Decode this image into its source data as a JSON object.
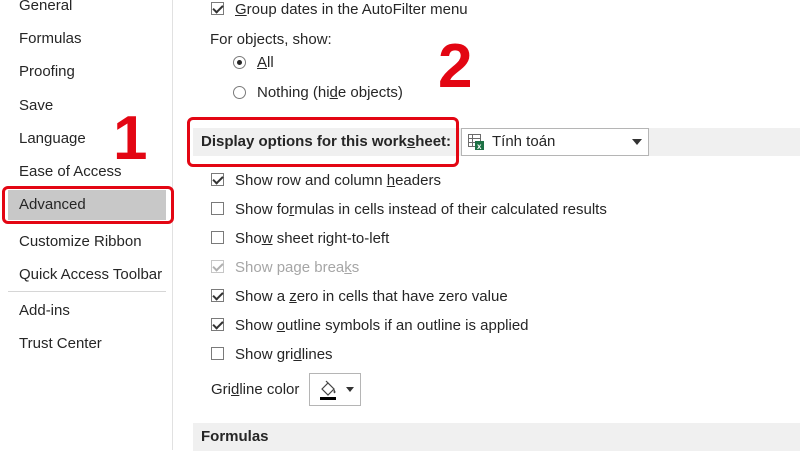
{
  "sidebar": {
    "items": [
      {
        "label": "General"
      },
      {
        "label": "Formulas"
      },
      {
        "label": "Proofing"
      },
      {
        "label": "Save"
      },
      {
        "label": "Language"
      },
      {
        "label": "Ease of Access"
      },
      {
        "label": "Advanced",
        "selected": true
      },
      {
        "label": "Customize Ribbon"
      },
      {
        "label": "Quick Access Toolbar"
      },
      {
        "label": "Add-ins"
      },
      {
        "label": "Trust Center"
      }
    ]
  },
  "annotations": {
    "step1": "1",
    "step2": "2",
    "highlight_color": "#e30613"
  },
  "main": {
    "group_dates": {
      "label_pre": "",
      "label_ul": "G",
      "label_post": "roup dates in the AutoFilter menu",
      "checked": true
    },
    "for_objects_label": "For objects, show:",
    "radio_all": {
      "label_pre": "",
      "label_ul": "A",
      "label_post": "ll",
      "selected": true
    },
    "radio_nothing": {
      "label_pre": "Nothing (hi",
      "label_ul": "d",
      "label_post": "e objects)",
      "selected": false
    },
    "display_section": {
      "title_pre": "Display options for this work",
      "title_ul": "s",
      "title_post": "heet:",
      "worksheet_select": {
        "value": "Tính toán",
        "icon": "excel-sheet-icon"
      }
    },
    "options": [
      {
        "pre": "Show row and column ",
        "ul": "h",
        "post": "eaders",
        "checked": true,
        "disabled": false
      },
      {
        "pre": "Show fo",
        "ul": "r",
        "post": "mulas in cells instead of their calculated results",
        "checked": false,
        "disabled": false
      },
      {
        "pre": "Sho",
        "ul": "w",
        "post": " sheet right-to-left",
        "checked": false,
        "disabled": false
      },
      {
        "pre": "Show page brea",
        "ul": "k",
        "post": "s",
        "checked": true,
        "disabled": true
      },
      {
        "pre": "Show a ",
        "ul": "z",
        "post": "ero in cells that have zero value",
        "checked": true,
        "disabled": false
      },
      {
        "pre": "Show ",
        "ul": "o",
        "post": "utline symbols if an outline is applied",
        "checked": true,
        "disabled": false
      },
      {
        "pre": "Show gri",
        "ul": "d",
        "post": "lines",
        "checked": false,
        "disabled": false
      }
    ],
    "gridline_color": {
      "pre": "Gri",
      "ul": "d",
      "post": "line color",
      "icon": "paint-bucket-icon"
    },
    "formulas_section": {
      "title": "Formulas"
    }
  }
}
